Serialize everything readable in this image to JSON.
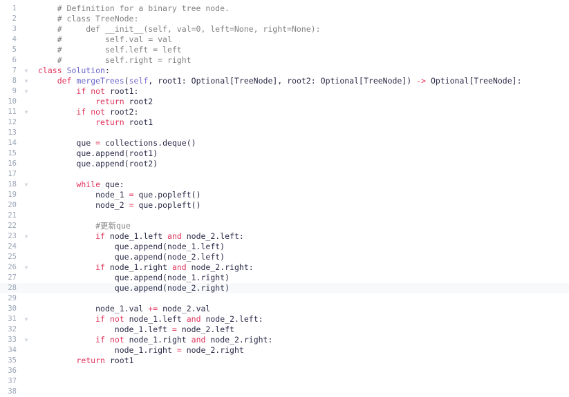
{
  "editor": {
    "name": "python-code-editor",
    "language": "Python",
    "current_line": 28,
    "colors": {
      "background": "#ffffff",
      "plain_text": "#2a2a48",
      "keyword": "#e0335a",
      "comment": "#808080",
      "class_name": "#6a66c9",
      "function_name": "#6a66c9",
      "line_number": "#99a4b5",
      "current_line_highlight": "#f7f9fb",
      "fold_marker": "#cfd6de"
    },
    "fold_marker_glyph": "▼",
    "fold_marker_lines": [
      7,
      8,
      9,
      11,
      18,
      23,
      26,
      31,
      33
    ],
    "first_line": 1,
    "last_line": 38,
    "lines": [
      {
        "num": 1,
        "text": "    # Definition for a binary tree node."
      },
      {
        "num": 2,
        "text": "    # class TreeNode:"
      },
      {
        "num": 3,
        "text": "    #     def __init__(self, val=0, left=None, right=None):"
      },
      {
        "num": 4,
        "text": "    #         self.val = val"
      },
      {
        "num": 5,
        "text": "    #         self.left = left"
      },
      {
        "num": 6,
        "text": "    #         self.right = right"
      },
      {
        "num": 7,
        "text": "class Solution:"
      },
      {
        "num": 8,
        "text": "    def mergeTrees(self, root1: Optional[TreeNode], root2: Optional[TreeNode]) -> Optional[TreeNode]:"
      },
      {
        "num": 9,
        "text": "        if not root1:"
      },
      {
        "num": 10,
        "text": "            return root2"
      },
      {
        "num": 11,
        "text": "        if not root2:"
      },
      {
        "num": 12,
        "text": "            return root1"
      },
      {
        "num": 13,
        "text": ""
      },
      {
        "num": 14,
        "text": "        que = collections.deque()"
      },
      {
        "num": 15,
        "text": "        que.append(root1)"
      },
      {
        "num": 16,
        "text": "        que.append(root2)"
      },
      {
        "num": 17,
        "text": ""
      },
      {
        "num": 18,
        "text": "        while que:"
      },
      {
        "num": 19,
        "text": "            node_1 = que.popleft()"
      },
      {
        "num": 20,
        "text": "            node_2 = que.popleft()"
      },
      {
        "num": 21,
        "text": ""
      },
      {
        "num": 22,
        "text": "            #更新que"
      },
      {
        "num": 23,
        "text": "            if node_1.left and node_2.left:"
      },
      {
        "num": 24,
        "text": "                que.append(node_1.left)"
      },
      {
        "num": 25,
        "text": "                que.append(node_2.left)"
      },
      {
        "num": 26,
        "text": "            if node_1.right and node_2.right:"
      },
      {
        "num": 27,
        "text": "                que.append(node_1.right)"
      },
      {
        "num": 28,
        "text": "                que.append(node_2.right)"
      },
      {
        "num": 29,
        "text": ""
      },
      {
        "num": 30,
        "text": "            node_1.val += node_2.val"
      },
      {
        "num": 31,
        "text": "            if not node_1.left and node_2.left:"
      },
      {
        "num": 32,
        "text": "                node_1.left = node_2.left"
      },
      {
        "num": 33,
        "text": "            if not node_1.right and node_2.right:"
      },
      {
        "num": 34,
        "text": "                node_1.right = node_2.right"
      },
      {
        "num": 35,
        "text": "        return root1"
      },
      {
        "num": 36,
        "text": ""
      },
      {
        "num": 37,
        "text": ""
      },
      {
        "num": 38,
        "text": ""
      }
    ]
  }
}
